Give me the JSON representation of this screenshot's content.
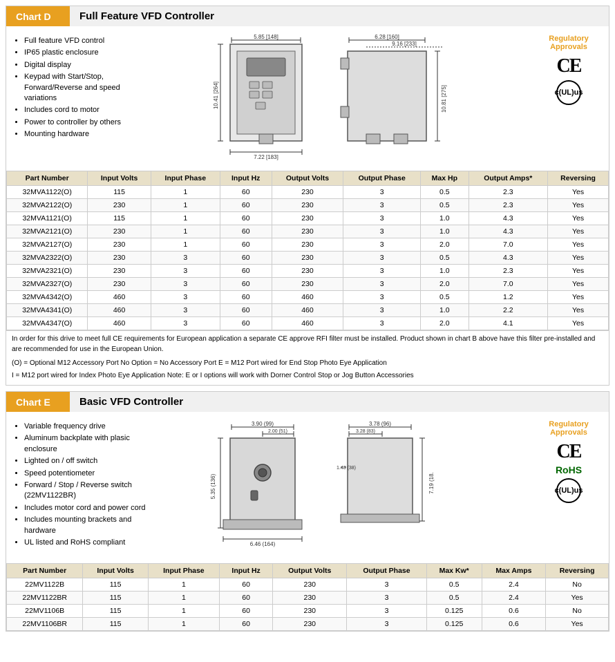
{
  "chartD": {
    "label": "Chart D",
    "title": "Full Feature VFD Controller",
    "bullets": [
      "Full feature VFD control",
      "IP65 plastic enclosure",
      "Digital display",
      "Keypad with Start/Stop, Forward/Reverse and speed variations",
      "Includes cord to motor",
      "Power to controller by others",
      "Mounting hardware"
    ],
    "approvals": {
      "title": "Regulatory Approvals"
    },
    "diagramD_front": {
      "width_top": "5.85 [148]",
      "width_side": "6.28 [160]",
      "height_left": "10.41 [264]",
      "height_right": "10.81 [275]",
      "depth": "9.16 [233]",
      "width_bottom": "7.22 [183]"
    },
    "tableHeaders": [
      "Part Number",
      "Input Volts",
      "Input Phase",
      "Input Hz",
      "Output Volts",
      "Output Phase",
      "Max Hp",
      "Output Amps*",
      "Reversing"
    ],
    "tableRows": [
      [
        "32MVA1122(O)",
        "115",
        "1",
        "60",
        "230",
        "3",
        "0.5",
        "2.3",
        "Yes"
      ],
      [
        "32MVA2122(O)",
        "230",
        "1",
        "60",
        "230",
        "3",
        "0.5",
        "2.3",
        "Yes"
      ],
      [
        "32MVA1121(O)",
        "115",
        "1",
        "60",
        "230",
        "3",
        "1.0",
        "4.3",
        "Yes"
      ],
      [
        "32MVA2121(O)",
        "230",
        "1",
        "60",
        "230",
        "3",
        "1.0",
        "4.3",
        "Yes"
      ],
      [
        "32MVA2127(O)",
        "230",
        "1",
        "60",
        "230",
        "3",
        "2.0",
        "7.0",
        "Yes"
      ],
      [
        "32MVA2322(O)",
        "230",
        "3",
        "60",
        "230",
        "3",
        "0.5",
        "4.3",
        "Yes"
      ],
      [
        "32MVA2321(O)",
        "230",
        "3",
        "60",
        "230",
        "3",
        "1.0",
        "2.3",
        "Yes"
      ],
      [
        "32MVA2327(O)",
        "230",
        "3",
        "60",
        "230",
        "3",
        "2.0",
        "7.0",
        "Yes"
      ],
      [
        "32MVA4342(O)",
        "460",
        "3",
        "60",
        "460",
        "3",
        "0.5",
        "1.2",
        "Yes"
      ],
      [
        "32MVA4341(O)",
        "460",
        "3",
        "60",
        "460",
        "3",
        "1.0",
        "2.2",
        "Yes"
      ],
      [
        "32MVA4347(O)",
        "460",
        "3",
        "60",
        "460",
        "3",
        "2.0",
        "4.1",
        "Yes"
      ]
    ],
    "note1": "In order for this drive to meet full CE requirements for European application a separate CE approve RFI filter must be installed.  Product shown in chart B above have this filter pre-installed and are recommended for use in the European Union.",
    "note2": "(O) = Optional M12 Accessory Port    No Option = No Accessory Port    E = M12 Port wired for End Stop Photo Eye Application",
    "note3": "I = M12 port wired for Index Photo Eye Application    Note: E or I options will work with Dorner Control Stop or Jog Button Accessories"
  },
  "chartE": {
    "label": "Chart E",
    "title": "Basic VFD Controller",
    "bullets": [
      "Variable frequency drive",
      "Aluminum backplate with plasic enclosure",
      "Lighted on / off switch",
      "Speed potentiometer",
      "Forward / Stop / Reverse switch (22MV1122BR)",
      "Includes motor cord and power cord",
      "Includes mounting brackets and hardware",
      "UL listed and RoHS compliant"
    ],
    "approvals": {
      "title": "Regulatory Approvals"
    },
    "tableHeaders": [
      "Part Number",
      "Input Volts",
      "Input Phase",
      "Input Hz",
      "Output Volts",
      "Output Phase",
      "Max Kw*",
      "Max Amps",
      "Reversing"
    ],
    "tableRows": [
      [
        "22MV1122B",
        "115",
        "1",
        "60",
        "230",
        "3",
        "0.5",
        "2.4",
        "No"
      ],
      [
        "22MV1122BR",
        "115",
        "1",
        "60",
        "230",
        "3",
        "0.5",
        "2.4",
        "Yes"
      ],
      [
        "22MV1106B",
        "115",
        "1",
        "60",
        "230",
        "3",
        "0.125",
        "0.6",
        "No"
      ],
      [
        "22MV1106BR",
        "115",
        "1",
        "60",
        "230",
        "3",
        "0.125",
        "0.6",
        "Yes"
      ]
    ]
  }
}
